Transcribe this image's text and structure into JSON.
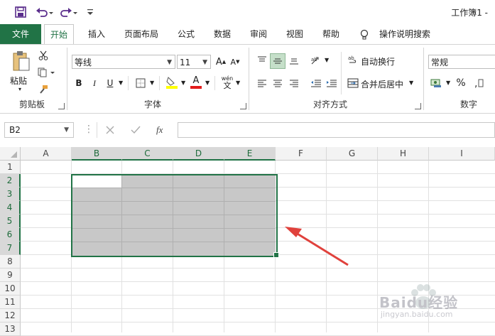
{
  "window": {
    "title": "工作簿1 -"
  },
  "tabs": [
    "文件",
    "开始",
    "插入",
    "页面布局",
    "公式",
    "数据",
    "审阅",
    "视图",
    "帮助",
    "操作说明搜索"
  ],
  "clipboard": {
    "paste_label": "粘贴",
    "group_label": "剪贴板"
  },
  "font": {
    "name": "等线",
    "size": "11",
    "group_label": "字体",
    "bold": "B",
    "italic": "I",
    "underline": "U",
    "grow": "A",
    "shrink": "A",
    "font_color_letter": "A",
    "pinyin": "wén"
  },
  "align": {
    "wrap_label": "自动换行",
    "merge_label": "合并后居中",
    "group_label": "对齐方式"
  },
  "number": {
    "format": "常规",
    "percent": "%",
    "group_label": "数字"
  },
  "formula_bar": {
    "name_box": "B2",
    "fx": "fx"
  },
  "grid": {
    "columns": [
      "A",
      "B",
      "C",
      "D",
      "E",
      "F",
      "G",
      "H",
      "I"
    ],
    "rows": [
      "1",
      "2",
      "3",
      "4",
      "5",
      "6",
      "7",
      "8",
      "9",
      "10",
      "11",
      "12",
      "13"
    ],
    "selected_range": "B2:E7"
  },
  "watermark": {
    "text": "Baidu经验",
    "url": "jingyan.baidu.com"
  },
  "colors": {
    "excel_green": "#217346",
    "selection_fill": "#c8c8c8",
    "arrow_red": "#e0413c",
    "font_color_bar": "#e21b1b",
    "highlight_bar": "#ffff00"
  }
}
